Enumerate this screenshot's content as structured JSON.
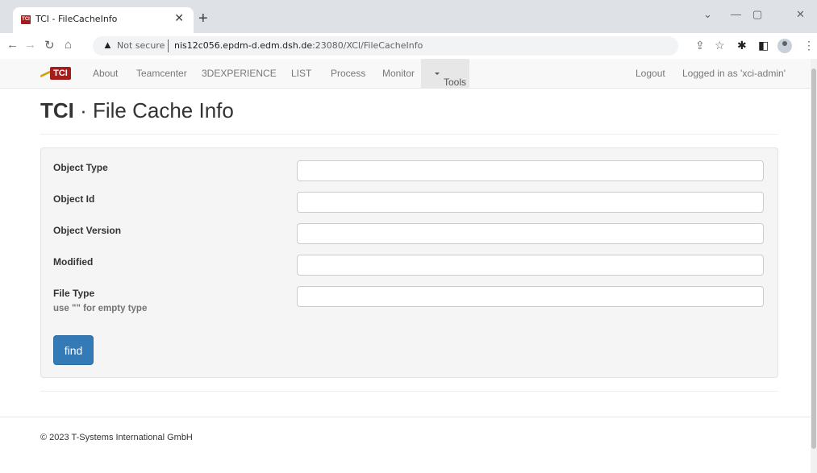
{
  "browser": {
    "tab_title": "TCI - FileCacheInfo",
    "tab_favicon_text": "TCI",
    "security_label": "Not secure",
    "url_host": "nis12c056.epdm-d.edm.dsh.de",
    "url_path": ":23080/XCI/FileCacheInfo"
  },
  "navbar": {
    "brand": "TCI",
    "links": [
      "About",
      "Teamcenter",
      "3DEXPERIENCE",
      "LIST",
      "Process",
      "Monitor"
    ],
    "tools": "Tools",
    "logout": "Logout",
    "logged_in": "Logged in as 'xci-admin'"
  },
  "page": {
    "title_bold": "TCI",
    "title_rest": " · File Cache Info"
  },
  "form": {
    "fields": [
      {
        "label": "Object Type",
        "value": ""
      },
      {
        "label": "Object Id",
        "value": ""
      },
      {
        "label": "Object Version",
        "value": ""
      },
      {
        "label": "Modified",
        "value": ""
      },
      {
        "label": "File Type",
        "help": "use \"\" for empty type",
        "value": ""
      }
    ],
    "find_label": "find"
  },
  "footer": {
    "copyright": "© 2023 T-Systems International GmbH"
  },
  "colors": {
    "brand_red": "#a31d1d",
    "button_blue": "#337ab7"
  }
}
